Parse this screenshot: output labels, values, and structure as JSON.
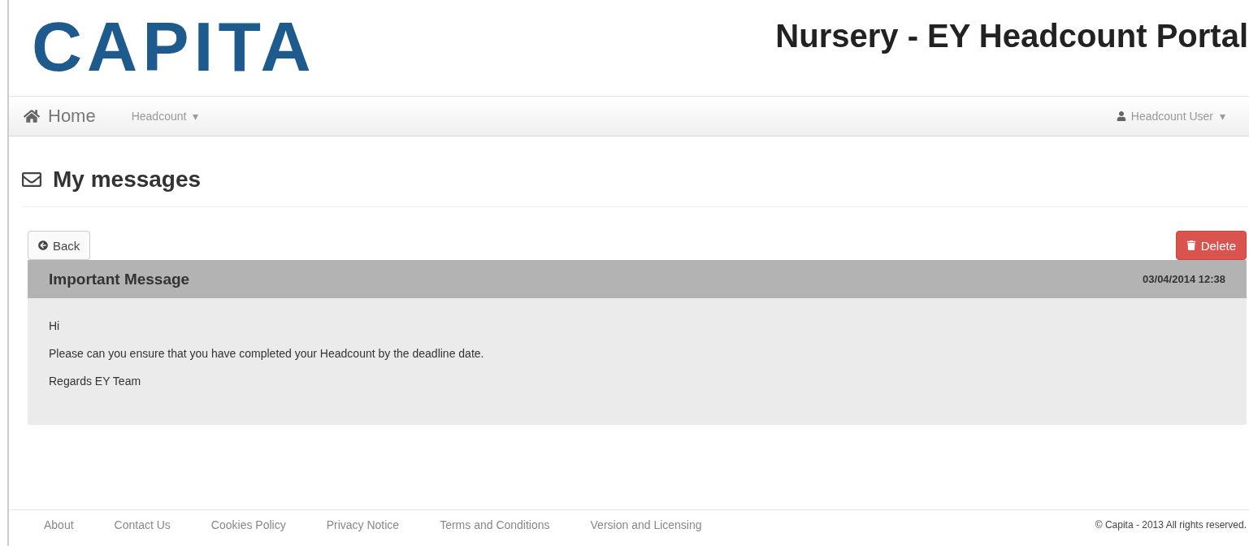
{
  "header": {
    "logo": "CAPITA",
    "title": "Nursery - EY Headcount Portal"
  },
  "nav": {
    "home": "Home",
    "menus": [
      {
        "label": "Headcount",
        "caret": "▾"
      }
    ],
    "user": {
      "label": "Headcount User",
      "caret": "▾"
    }
  },
  "page": {
    "heading": "My messages"
  },
  "actions": [
    {
      "kind": "back",
      "label": "Back"
    },
    {
      "kind": "delete",
      "label": "Delete"
    }
  ],
  "message": {
    "subject": "Important Message",
    "date": "03/04/2014 12:38",
    "body": [
      "Hi",
      "Please can you ensure that you have completed your Headcount by the deadline date.",
      "Regards EY Team"
    ]
  },
  "footer": {
    "links": [
      "About",
      "Contact Us",
      "Cookies Policy",
      "Privacy Notice",
      "Terms and Conditions",
      "Version and Licensing"
    ],
    "copyright": "© Capita - 2013 All rights reserved."
  }
}
